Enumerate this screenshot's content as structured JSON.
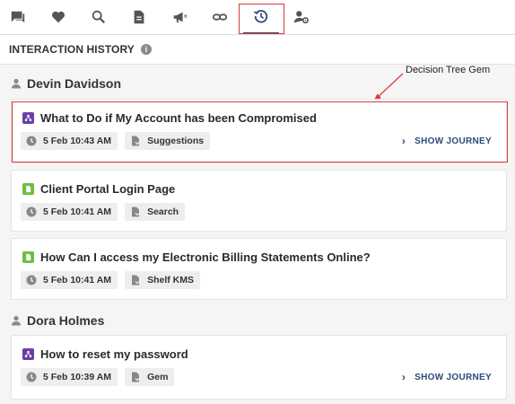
{
  "tabs": [
    {
      "icon": "chat-bubble-icon"
    },
    {
      "icon": "heart-icon"
    },
    {
      "icon": "search-icon"
    },
    {
      "icon": "document-icon"
    },
    {
      "icon": "megaphone-icon"
    },
    {
      "icon": "link-icon"
    },
    {
      "icon": "history-icon",
      "active": true
    },
    {
      "icon": "user-settings-icon"
    }
  ],
  "section": {
    "title": "INTERACTION HISTORY",
    "info_icon": "i"
  },
  "annotation": {
    "label": "Decision Tree Gem"
  },
  "groups": [
    {
      "name": "Devin Davidson",
      "items": [
        {
          "type": "gem",
          "title": "What to Do if My Account has been Compromised",
          "time": "5 Feb 10:43 AM",
          "source": "Suggestions",
          "journey": "SHOW JOURNEY"
        },
        {
          "type": "doc",
          "title": "Client Portal Login Page",
          "time": "5 Feb 10:41 AM",
          "source": "Search"
        },
        {
          "type": "doc",
          "title": "How Can I access my Electronic Billing Statements Online?",
          "time": "5 Feb 10:41 AM",
          "source": "Shelf KMS"
        }
      ]
    },
    {
      "name": "Dora Holmes",
      "items": [
        {
          "type": "gem",
          "title": "How to reset my password",
          "time": "5 Feb 10:39 AM",
          "source": "Gem",
          "journey": "SHOW JOURNEY"
        }
      ]
    }
  ],
  "colors": {
    "accent": "#2c4a7a",
    "highlight": "#d93a3a",
    "gem": "#6a3fa6",
    "doc": "#6cbf3f"
  }
}
